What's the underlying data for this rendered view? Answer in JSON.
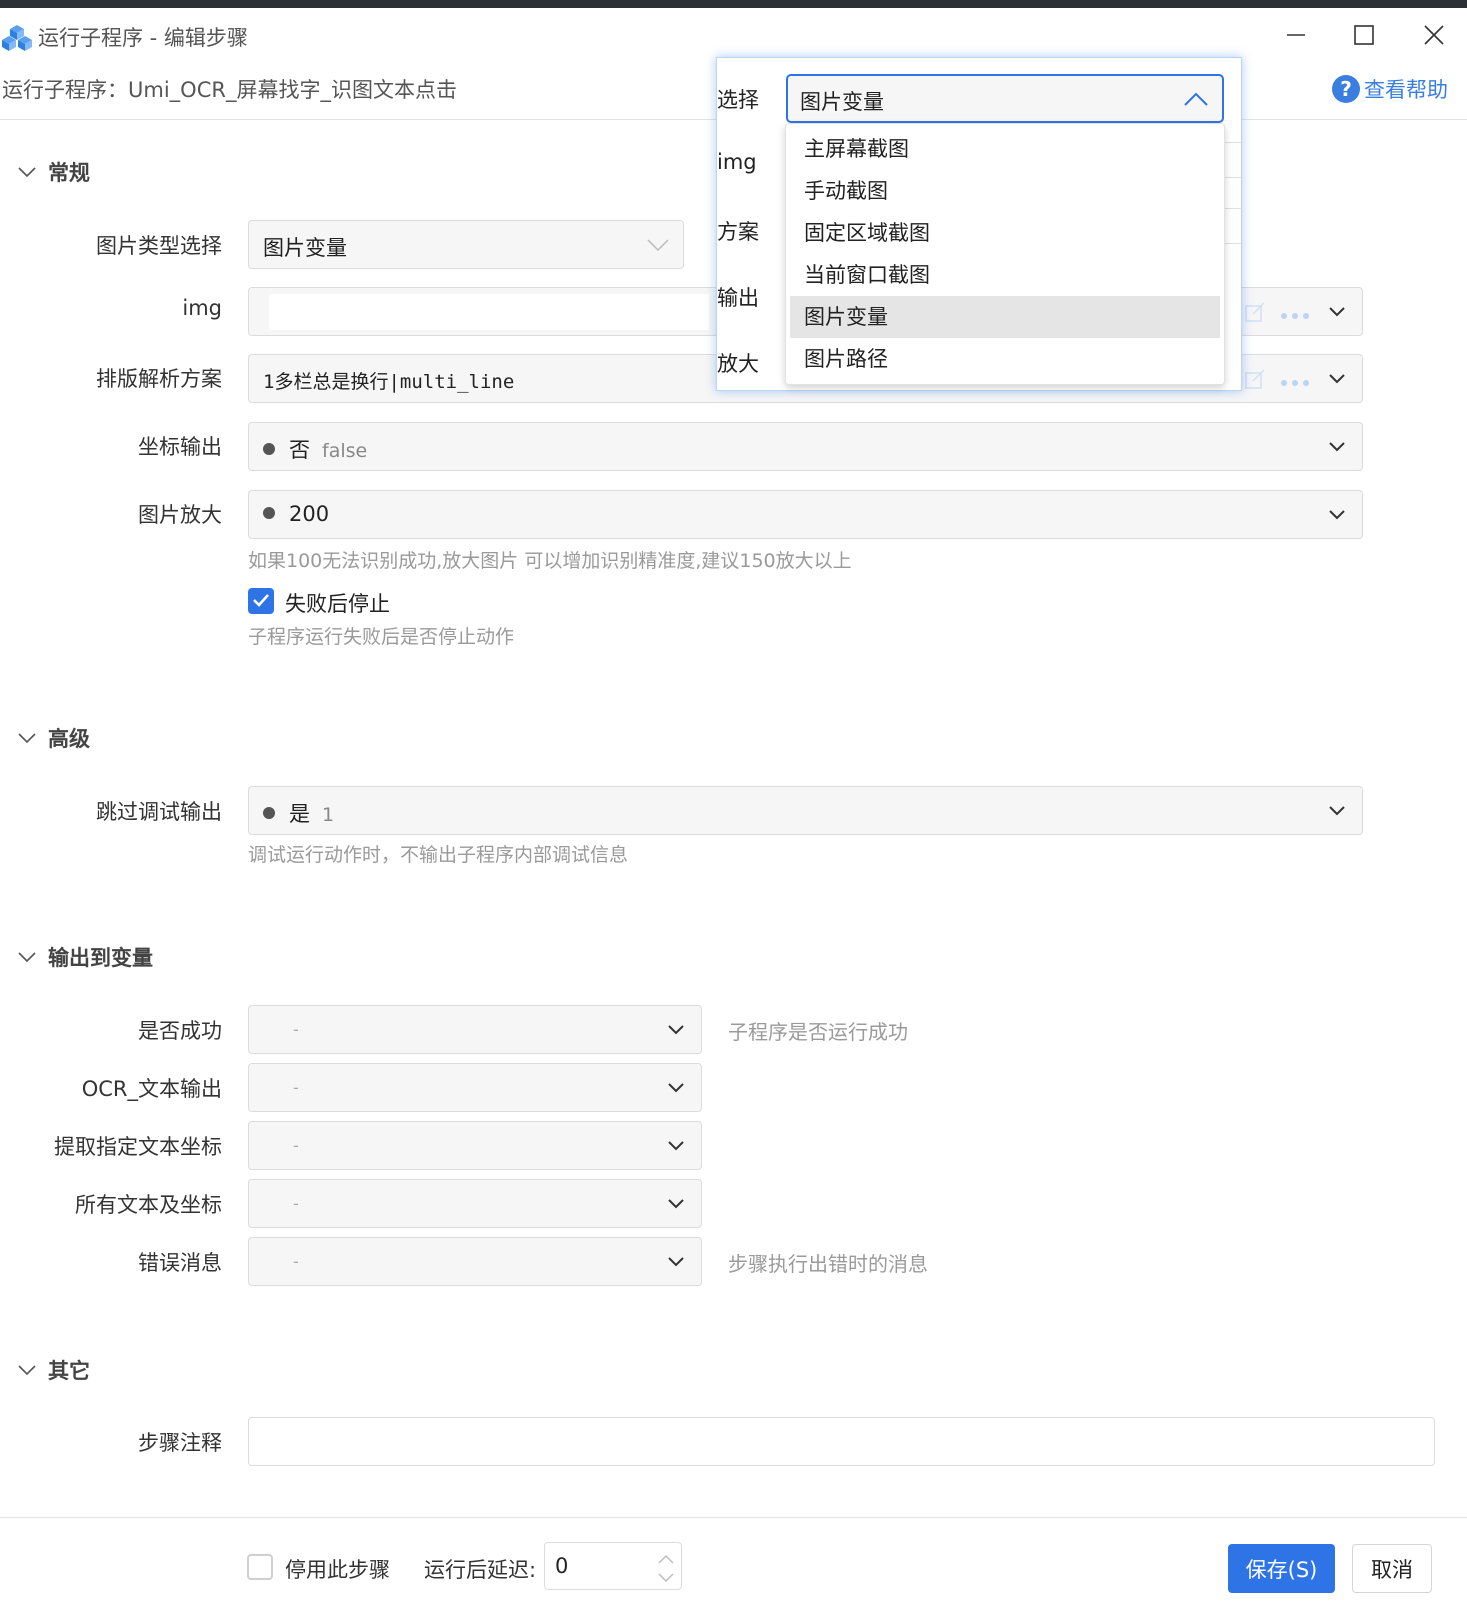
{
  "window": {
    "title": "运行子程序 - 编辑步骤"
  },
  "header": {
    "breadcrumb": "运行子程序：Umi_OCR_屏幕找字_识图文本点击",
    "help_label": "查看帮助"
  },
  "sections": {
    "general": "常规",
    "advanced": "高级",
    "output": "输出到变量",
    "other": "其它"
  },
  "general": {
    "image_type": {
      "label": "图片类型选择",
      "value": "图片变量"
    },
    "img": {
      "label": "img",
      "value": ""
    },
    "layout": {
      "label": "排版解析方案",
      "value": "1多栏总是换行|multi_line"
    },
    "coord_output": {
      "label": "坐标输出",
      "value": "否",
      "sub": "false"
    },
    "zoom": {
      "label": "图片放大",
      "value": "200",
      "hint": "如果100无法识别成功,放大图片 可以增加识别精准度,建议150放大以上"
    },
    "stop_on_fail": {
      "label": "失败后停止",
      "checked": true,
      "hint": "子程序运行失败后是否停止动作"
    }
  },
  "advanced": {
    "skip_debug": {
      "label": "跳过调试输出",
      "value": "是",
      "sub": "1",
      "hint": "调试运行动作时，不输出子程序内部调试信息"
    }
  },
  "output": {
    "success": {
      "label": "是否成功",
      "value": "-",
      "hint": "子程序是否运行成功"
    },
    "ocr_text": {
      "label": "OCR_文本输出",
      "value": "-"
    },
    "extract_coord": {
      "label": "提取指定文本坐标",
      "value": "-"
    },
    "all_text": {
      "label": "所有文本及坐标",
      "value": "-"
    },
    "error_msg": {
      "label": "错误消息",
      "value": "-",
      "hint": "步骤执行出错时的消息"
    }
  },
  "other": {
    "note": {
      "label": "步骤注释",
      "value": ""
    }
  },
  "footer": {
    "disable_label": "停用此步骤",
    "delay_label": "运行后延迟:",
    "delay_value": "0",
    "save_label": "保存(S)",
    "cancel_label": "取消"
  },
  "popup": {
    "labels": [
      "选择",
      "img",
      "方案",
      "输出",
      "放大"
    ],
    "selected": "图片变量",
    "options": [
      "主屏幕截图",
      "手动截图",
      "固定区域截图",
      "当前窗口截图",
      "图片变量",
      "图片路径"
    ],
    "selected_index": 4
  },
  "colors": {
    "accent": "#2f74e6",
    "help": "#3a7ee0",
    "hint": "#9a9a9a"
  }
}
